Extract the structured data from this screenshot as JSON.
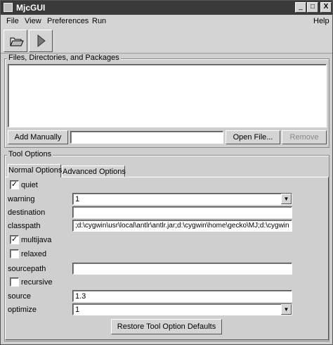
{
  "window": {
    "title": "MjcGUI",
    "minimize": "_",
    "maximize": "□",
    "close": "X"
  },
  "menu": {
    "file": "File",
    "view": "View",
    "preferences": "Preferences",
    "run": "Run",
    "help": "Help"
  },
  "toolbar": {
    "open_icon": "folder-icon",
    "run_icon": "play-icon"
  },
  "files_group": {
    "title": "Files, Directories, and Packages",
    "add_manually": "Add Manually",
    "path_value": "",
    "open_file": "Open File...",
    "remove": "Remove"
  },
  "tool_options": {
    "title": "Tool Options",
    "tabs": [
      {
        "label": "Normal Options"
      },
      {
        "label": "Advanced Options"
      }
    ],
    "quiet": {
      "label": "quiet",
      "checked": true,
      "mark": "✓"
    },
    "warning": {
      "label": "warning",
      "value": "1"
    },
    "destination": {
      "label": "destination",
      "value": ""
    },
    "classpath": {
      "label": "classpath",
      "value": ";d:\\cygwin\\usr\\local\\antlr\\antlr.jar;d:\\cygwin\\home\\gecko\\MJ;d:\\cygwin"
    },
    "multijava": {
      "label": "multijava",
      "checked": true,
      "mark": "✓"
    },
    "relaxed": {
      "label": "relaxed",
      "checked": false,
      "mark": ""
    },
    "sourcepath": {
      "label": "sourcepath",
      "value": ""
    },
    "recursive": {
      "label": "recursive",
      "checked": false,
      "mark": ""
    },
    "source": {
      "label": "source",
      "value": "1.3"
    },
    "optimize": {
      "label": "optimize",
      "value": "1"
    },
    "restore": "Restore Tool Option Defaults"
  }
}
